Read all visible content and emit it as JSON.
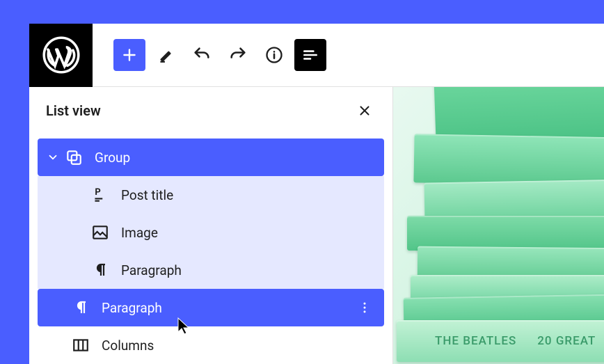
{
  "panel": {
    "title": "List view"
  },
  "tree": {
    "root": {
      "label": "Group"
    },
    "children": [
      {
        "label": "Post title",
        "icon": "post-title"
      },
      {
        "label": "Image",
        "icon": "image"
      },
      {
        "label": "Paragraph",
        "icon": "paragraph"
      }
    ],
    "siblings": [
      {
        "label": "Paragraph",
        "icon": "paragraph",
        "selected": true
      },
      {
        "label": "Columns",
        "icon": "columns"
      }
    ]
  },
  "canvas": {
    "spine1": "THE BEATLES",
    "spine2": "20 GREAT"
  }
}
